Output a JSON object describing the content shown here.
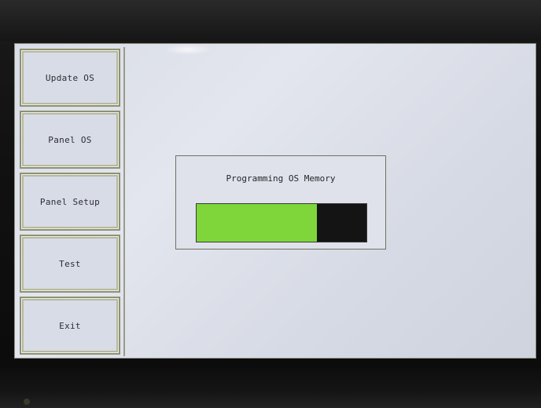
{
  "sidebar": {
    "items": [
      {
        "label": "Update OS"
      },
      {
        "label": "Panel OS"
      },
      {
        "label": "Panel Setup"
      },
      {
        "label": "Test"
      },
      {
        "label": "Exit"
      }
    ]
  },
  "dialog": {
    "title": "Programming OS Memory",
    "progress_fraction": 0.71
  },
  "colors": {
    "progress_fill": "#7ed63a",
    "progress_track": "#141414",
    "screen_bg": "#dde0e8"
  }
}
